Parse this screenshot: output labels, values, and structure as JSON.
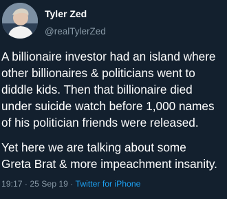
{
  "user": {
    "display_name": "Tyler Zed",
    "handle": "@realTylerZed"
  },
  "tweet": {
    "lines_p1": [
      "A billionaire investor had an island where",
      "other billionaires & politicians went to",
      "diddle kids. Then that billionaire died",
      "under suicide watch before 1,000 names",
      "of his politician friends were released."
    ],
    "lines_p2": [
      "Yet here we are talking about some",
      "Greta Brat & more impeachment insanity."
    ]
  },
  "meta": {
    "time": "19:17",
    "separator": "·",
    "date": "25 Sep 19",
    "source": "Twitter for iPhone"
  },
  "colors": {
    "background": "#13202e",
    "text": "#ffffff",
    "muted": "#8899a6",
    "link": "#1da1f2"
  }
}
